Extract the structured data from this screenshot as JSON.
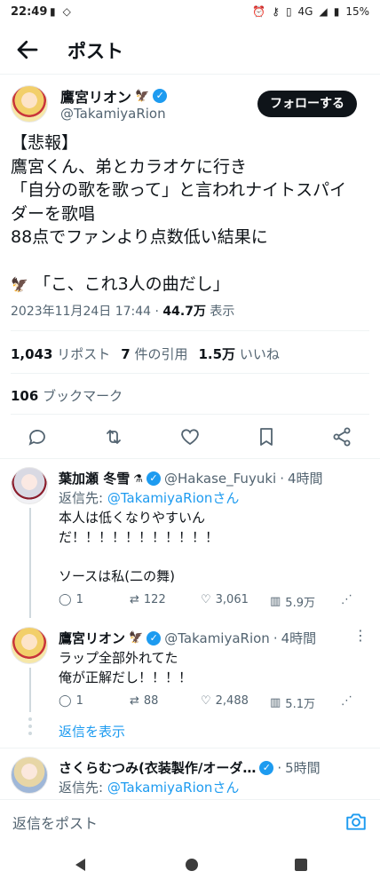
{
  "status_bar": {
    "time": "22:49",
    "network": "4G",
    "battery": "15%"
  },
  "header": {
    "title": "ポスト"
  },
  "post": {
    "author_name": "鷹宮リオン",
    "author_handle": "@TakamiyaRion",
    "follow_label": "フォローする",
    "body_lines": [
      "【悲報】",
      "鷹宮くん、弟とカラオケに行き",
      "「自分の歌を歌って」と言われナイトスパイ",
      "ダーを歌唱",
      "88点でファンより点数低い結果に",
      "",
      "「こ、これ3人の曲だし」"
    ],
    "timestamp": "2023年11月24日 17:44",
    "views_count": "44.7万",
    "views_label": "表示",
    "reposts_count": "1,043",
    "reposts_label": "リポスト",
    "quotes_count": "7",
    "quotes_label": "件の引用",
    "likes_count": "1.5万",
    "likes_label": "いいね",
    "bookmarks_count": "106",
    "bookmarks_label": "ブックマーク"
  },
  "replies": [
    {
      "name": "葉加瀬 冬雪",
      "handle": "@Hakase_Fuyuki",
      "time": "4時間",
      "reply_to_prefix": "返信先: ",
      "reply_to": "@TakamiyaRionさん",
      "text_lines": [
        "本人は低くなりやすいん",
        "だ！！！！！！！！！！！",
        "",
        "ソースは私(二の舞)"
      ],
      "replies": "1",
      "reposts": "122",
      "likes": "3,061",
      "views": "5.9万"
    },
    {
      "name": "鷹宮リオン",
      "handle": "@TakamiyaRion",
      "time": "4時間",
      "text_lines": [
        "ラップ全部外れてた",
        "俺が正解だし！！！！"
      ],
      "replies": "1",
      "reposts": "88",
      "likes": "2,488",
      "views": "5.1万"
    },
    {
      "name": "さくらむつみ(衣装製作/オーダ…",
      "time": "5時間",
      "reply_to_prefix": "返信先: ",
      "reply_to": "@TakamiyaRionさん"
    }
  ],
  "show_replies_label": "返信を表示",
  "compose_placeholder": "返信をポスト",
  "colors": {
    "accent": "#1d9bf0",
    "text": "#0f1419",
    "secondary": "#536471",
    "divider": "#eff3f4"
  }
}
